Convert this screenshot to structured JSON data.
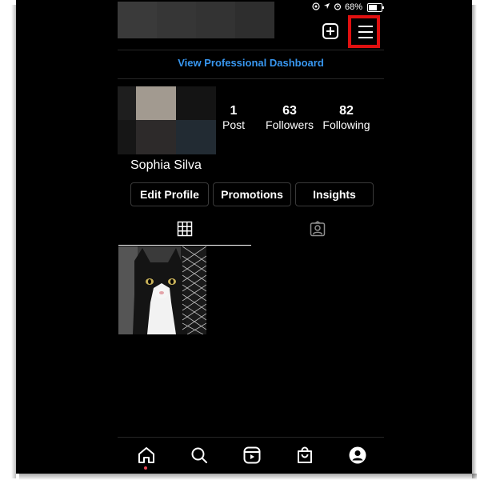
{
  "status_bar": {
    "battery": "68%",
    "battery_level": 0.68
  },
  "header": {
    "add_icon": "plus-square-icon",
    "menu_icon": "hamburger-menu-icon",
    "menu_highlight_color": "#e01010"
  },
  "dashboard_link": "View Professional Dashboard",
  "profile": {
    "name": "Sophia Silva",
    "stats": [
      {
        "value": "1",
        "label": "Post"
      },
      {
        "value": "63",
        "label": "Followers"
      },
      {
        "value": "82",
        "label": "Following"
      }
    ]
  },
  "buttons": {
    "edit_profile": "Edit Profile",
    "promotions": "Promotions",
    "insights": "Insights"
  },
  "tabs": [
    {
      "icon": "grid-icon",
      "active": true
    },
    {
      "icon": "tagged-person-icon",
      "active": false
    }
  ],
  "posts": [
    {
      "subject": "black and white cat behind wire fence"
    }
  ],
  "bottom_nav": [
    {
      "icon": "home-icon",
      "active": true
    },
    {
      "icon": "search-icon",
      "active": false
    },
    {
      "icon": "reels-icon",
      "active": false
    },
    {
      "icon": "shop-bag-icon",
      "active": false
    },
    {
      "icon": "profile-icon",
      "active": false
    }
  ],
  "colors": {
    "background": "#000000",
    "link": "#3897f0",
    "notification_dot": "#ed4956"
  }
}
